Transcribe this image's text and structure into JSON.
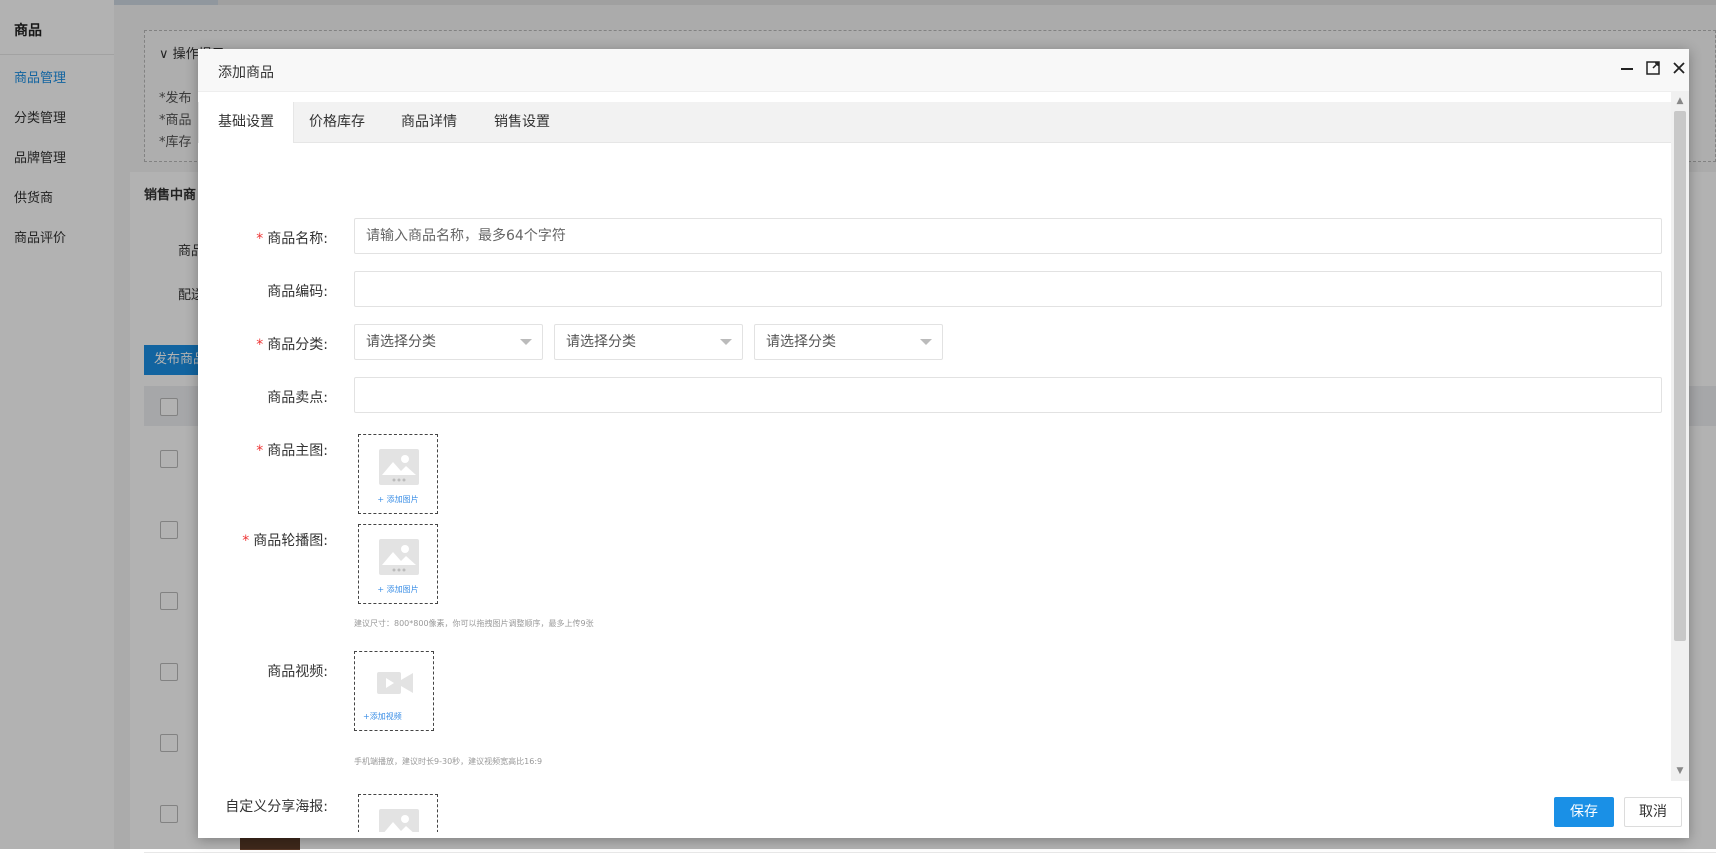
{
  "sidebar": {
    "title": "商品",
    "items": [
      {
        "label": "商品管理",
        "active": true
      },
      {
        "label": "分类管理"
      },
      {
        "label": "品牌管理"
      },
      {
        "label": "供货商"
      },
      {
        "label": "商品评价"
      }
    ]
  },
  "background": {
    "tip_header": "操作提示",
    "tip_lines": [
      "*发布",
      "*商品",
      "*库存"
    ],
    "panel_title": "销售中商",
    "filter_1": "商品",
    "filter_2": "配送",
    "publish_button": "发布商品"
  },
  "modal": {
    "title": "添加商品",
    "tabs": [
      "基础设置",
      "价格库存",
      "商品详情",
      "销售设置"
    ],
    "form": {
      "name_label": "商品名称:",
      "name_placeholder": "请输入商品名称，最多64个字符",
      "code_label": "商品编码:",
      "code_value": "",
      "category_label": "商品分类:",
      "category_selects": [
        "请选择分类",
        "请选择分类",
        "请选择分类"
      ],
      "selling_point_label": "商品卖点:",
      "selling_point_value": "",
      "main_image_label": "商品主图:",
      "carousel_label": "商品轮播图:",
      "add_image": "+ 添加图片",
      "image_hint": "建议尺寸：800*800像素，你可以拖拽图片调整顺序，最多上传9张",
      "video_label": "商品视频:",
      "add_video": "+添加视频",
      "video_hint": "手机端播放，建议时长9-30秒，建议视频宽高比16:9",
      "poster_label": "自定义分享海报:"
    },
    "buttons": {
      "save": "保存",
      "cancel": "取消"
    }
  },
  "colors": {
    "accent": "#1a90e6",
    "required": "#e33333"
  }
}
